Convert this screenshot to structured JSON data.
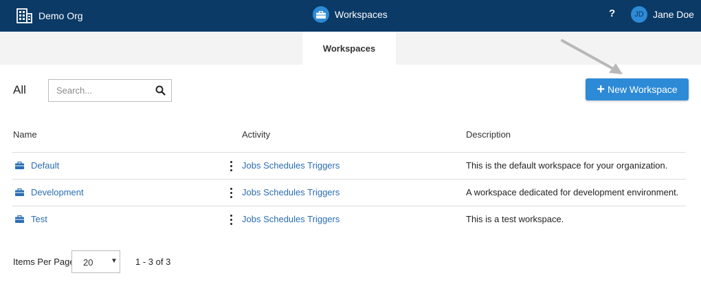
{
  "header": {
    "org_name": "Demo Org",
    "org_icon": "building-icon",
    "center_title": "Workspaces",
    "center_icon": "briefcase-icon",
    "help_label": "?",
    "user_initials": "JD",
    "user_name": "Jane Doe"
  },
  "tabs": [
    {
      "label": "Workspaces",
      "active": true
    }
  ],
  "toolbar": {
    "filter_label": "All",
    "search_placeholder": "Search...",
    "search_icon": "search-icon",
    "new_button_plus": "+",
    "new_button_label": "New Workspace"
  },
  "table": {
    "columns": [
      "Name",
      "Activity",
      "Description"
    ],
    "rows": [
      {
        "name": "Default",
        "activity": "Jobs Schedules Triggers",
        "description": "This is the default workspace for your organization."
      },
      {
        "name": "Development",
        "activity": "Jobs Schedules Triggers",
        "description": "A workspace dedicated for development environment."
      },
      {
        "name": "Test",
        "activity": "Jobs Schedules Triggers",
        "description": "This is a test workspace."
      }
    ]
  },
  "pagination": {
    "items_per_page_label": "Items Per Page",
    "items_per_page_value": "20",
    "range_text": "1 - 3 of 3"
  },
  "colors": {
    "topbar": "#0b3a66",
    "accent": "#2d8ad6",
    "link": "#2a6db3",
    "tabstrip": "#f3f3f3"
  }
}
